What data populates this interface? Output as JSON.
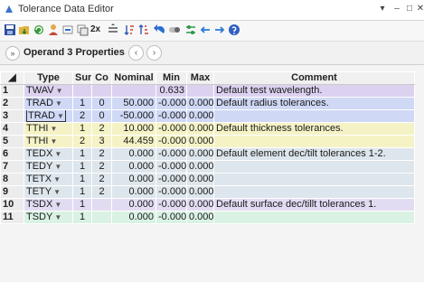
{
  "window": {
    "title": "Tolerance Data Editor",
    "controls": [
      "▾",
      "–",
      "□",
      "✕"
    ]
  },
  "toolbar_icons": [
    "save-icon",
    "load-icon",
    "reload-icon",
    "wizard-icon",
    "insert-row-icon",
    "duplicate-icon",
    "times-two-icon",
    "sort-icon",
    "sort-desc-icon",
    "sort-asc-icon",
    "undo-icon",
    "toggle-icon",
    "sliders-icon",
    "arrow-left-icon",
    "arrow-right-icon",
    "help-icon"
  ],
  "toolbar_labels": {
    "times_two": "2x"
  },
  "operand_bar": {
    "collapse": "»",
    "label": "Operand  3 Properties",
    "prev": "‹",
    "next": "›"
  },
  "columns": [
    "Type",
    "Sur",
    "Co",
    "Nominal",
    "Min",
    "Max",
    "Comment"
  ],
  "rows": [
    {
      "n": "1",
      "type": "TWAV",
      "has_arrow": true,
      "sur": "",
      "co": "",
      "nominal": "",
      "min": "0.633",
      "max": "",
      "comment": "Default test wavelength.",
      "color": "#ddd1f0"
    },
    {
      "n": "2",
      "type": "TRAD",
      "has_arrow": true,
      "sur": "1",
      "co": "0",
      "nominal": "50.000",
      "min": "-0.000",
      "max": "0.000",
      "comment": "Default radius tolerances.",
      "color": "#cfd8f5"
    },
    {
      "n": "3",
      "type": "TRAD",
      "has_arrow": true,
      "sur": "2",
      "co": "0",
      "nominal": "-50.000",
      "min": "-0.000",
      "max": "0.000",
      "comment": "",
      "color": "#cfd8f5",
      "selected": true
    },
    {
      "n": "4",
      "type": "TTHI",
      "has_arrow": true,
      "sur": "1",
      "co": "2",
      "nominal": "10.000",
      "min": "-0.000",
      "max": "0.000",
      "comment": "Default thickness tolerances.",
      "color": "#f5f3c6"
    },
    {
      "n": "5",
      "type": "TTHI",
      "has_arrow": true,
      "sur": "2",
      "co": "3",
      "nominal": "44.459",
      "min": "-0.000",
      "max": "0.000",
      "comment": "",
      "color": "#f5f3c6"
    },
    {
      "n": "6",
      "type": "TEDX",
      "has_arrow": true,
      "sur": "1",
      "co": "2",
      "nominal": "0.000",
      "min": "-0.000",
      "max": "0.000",
      "comment": "Default element dec/tilt tolerances 1-2.",
      "color": "#dde6ec"
    },
    {
      "n": "7",
      "type": "TEDY",
      "has_arrow": true,
      "sur": "1",
      "co": "2",
      "nominal": "0.000",
      "min": "-0.000",
      "max": "0.000",
      "comment": "",
      "color": "#dde6ec"
    },
    {
      "n": "8",
      "type": "TETX",
      "has_arrow": true,
      "sur": "1",
      "co": "2",
      "nominal": "0.000",
      "min": "-0.000",
      "max": "0.000",
      "comment": "",
      "color": "#dde6ec"
    },
    {
      "n": "9",
      "type": "TETY",
      "has_arrow": true,
      "sur": "1",
      "co": "2",
      "nominal": "0.000",
      "min": "-0.000",
      "max": "0.000",
      "comment": "",
      "color": "#dde6ec"
    },
    {
      "n": "10",
      "type": "TSDX",
      "has_arrow": true,
      "sur": "1",
      "co": "",
      "nominal": "0.000",
      "min": "-0.000",
      "max": "0.000",
      "comment": "Default surface dec/tillt tolerances 1.",
      "color": "#e2dcf3"
    },
    {
      "n": "11",
      "type": "TSDY",
      "has_arrow": true,
      "sur": "1",
      "co": "",
      "nominal": "0.000",
      "min": "-0.000",
      "max": "0.000",
      "comment": "",
      "color": "#d9f2e3"
    }
  ]
}
